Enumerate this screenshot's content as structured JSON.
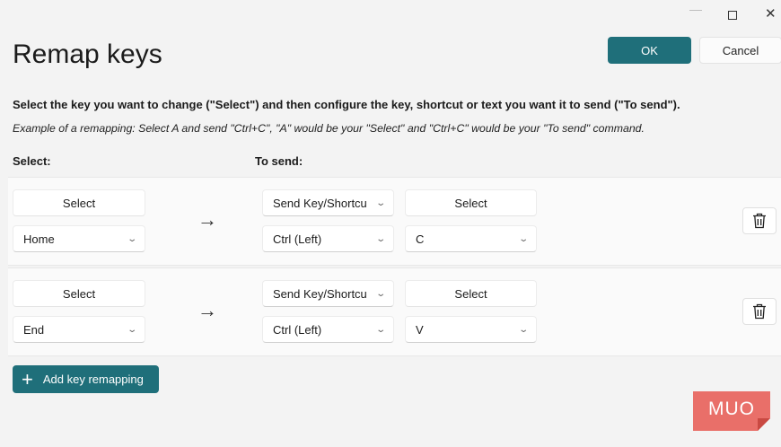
{
  "window": {
    "minimize_icon": "—",
    "maximize_icon": "maximize-icon",
    "close_icon": "✕"
  },
  "header": {
    "title": "Remap keys",
    "ok_label": "OK",
    "cancel_label": "Cancel"
  },
  "instructions": {
    "main": "Select the key you want to change (\"Select\") and then configure the key, shortcut or text you want it to send (\"To send\").",
    "example": "Example of a remapping: Select A and send \"Ctrl+C\", \"A\" would be your \"Select\" and \"Ctrl+C\" would be your \"To send\" command."
  },
  "columns": {
    "select": "Select:",
    "to_send": "To send:"
  },
  "rows": [
    {
      "select_button": "Select",
      "select_value": "Home",
      "arrow": "→",
      "send_type": "Send Key/Shortcu",
      "send_modifier": "Ctrl (Left)",
      "send_select_button": "Select",
      "send_key": "C"
    },
    {
      "select_button": "Select",
      "select_value": "End",
      "arrow": "→",
      "send_type": "Send Key/Shortcu",
      "send_modifier": "Ctrl (Left)",
      "send_select_button": "Select",
      "send_key": "V"
    }
  ],
  "add_button": {
    "icon": "+",
    "label": "Add key remapping"
  },
  "watermark": {
    "text": "MUO"
  },
  "colors": {
    "accent": "#1f6f7a",
    "background": "#f3f3f3",
    "watermark": "#e8615a"
  },
  "icons": {
    "chevron": "chevron-down-icon",
    "delete": "trash-icon"
  }
}
